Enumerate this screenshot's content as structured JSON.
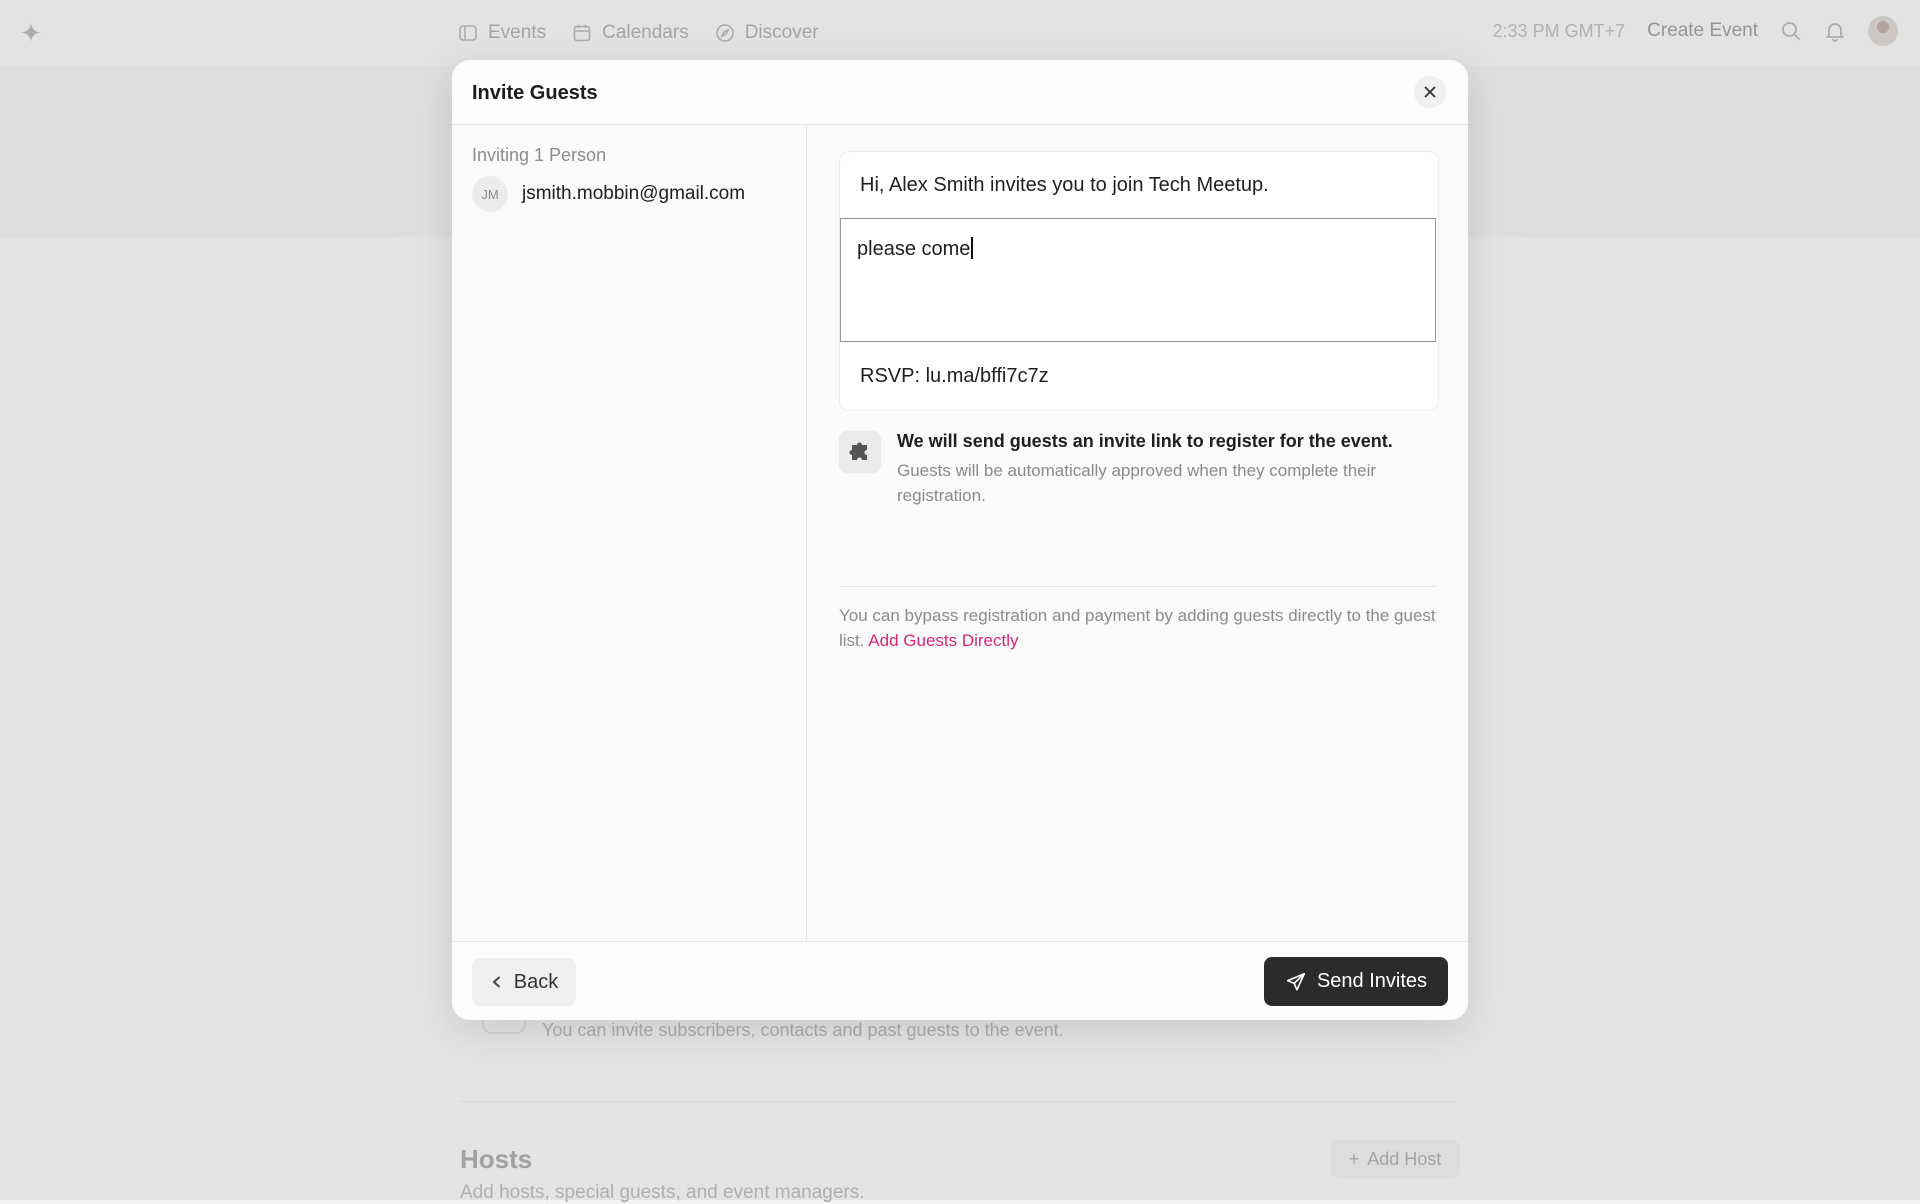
{
  "topbar": {
    "nav": [
      {
        "label": "Events",
        "icon": "ticket-icon"
      },
      {
        "label": "Calendars",
        "icon": "calendar-icon"
      },
      {
        "label": "Discover",
        "icon": "compass-icon"
      }
    ],
    "time": "2:33 PM GMT+7",
    "create_event": "Create Event"
  },
  "background": {
    "invite_hint": "You can invite subscribers, contacts and past guests to the event.",
    "hosts_title": "Hosts",
    "hosts_subtitle": "Add hosts, special guests, and event managers.",
    "add_host": "Add Host"
  },
  "modal": {
    "title": "Invite Guests",
    "inviting_label": "Inviting 1 Person",
    "guests": [
      {
        "initials": "JM",
        "email": "jsmith.mobbin@gmail.com"
      }
    ],
    "message": {
      "greeting": "Hi, Alex Smith invites you to join Tech Meetup.",
      "custom_text": "please come",
      "rsvp": "RSVP: lu.ma/bffi7c7z"
    },
    "info": {
      "title": "We will send guests an invite link to register for the event.",
      "subtitle": "Guests will be automatically approved when they complete their registration."
    },
    "bypass": {
      "text": "You can bypass registration and payment by adding guests directly to the guest list.",
      "link": "Add Guests Directly"
    },
    "footer": {
      "back": "Back",
      "send": "Send Invites"
    }
  },
  "colors": {
    "accent_link": "#d6287a",
    "primary_button": "#2b2b2b"
  }
}
